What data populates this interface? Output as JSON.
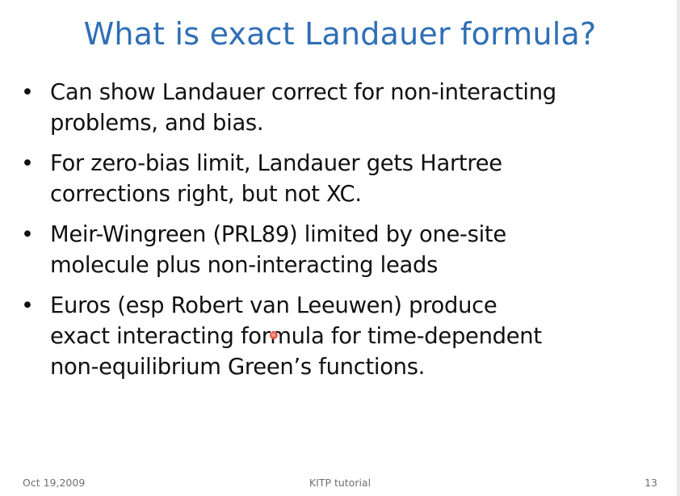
{
  "slide": {
    "title": "What is exact Landauer formula?",
    "bullet_symbol": "•",
    "bullets": [
      {
        "lines": [
          "Can show Landauer correct for non-interacting",
          "problems, and bias."
        ]
      },
      {
        "lines": [
          "For zero-bias limit, Landauer gets Hartree",
          "corrections right, but not XC."
        ]
      },
      {
        "lines": [
          "Meir-Wingreen (PRL89) limited by one-site",
          "molecule plus non-interacting leads"
        ]
      },
      {
        "lines": [
          "Euros (esp Robert van Leeuwen) produce",
          "exact interacting formula for time-dependent",
          "non-equilibrium Green’s functions."
        ]
      }
    ]
  },
  "footer": {
    "date": "Oct 19,2009",
    "center": "KITP tutorial",
    "page_number": "13"
  },
  "colors": {
    "title": "#2f6fb6",
    "body_text": "#111111",
    "footer_text": "#6f6f6f",
    "pointer": "#e0503a"
  }
}
